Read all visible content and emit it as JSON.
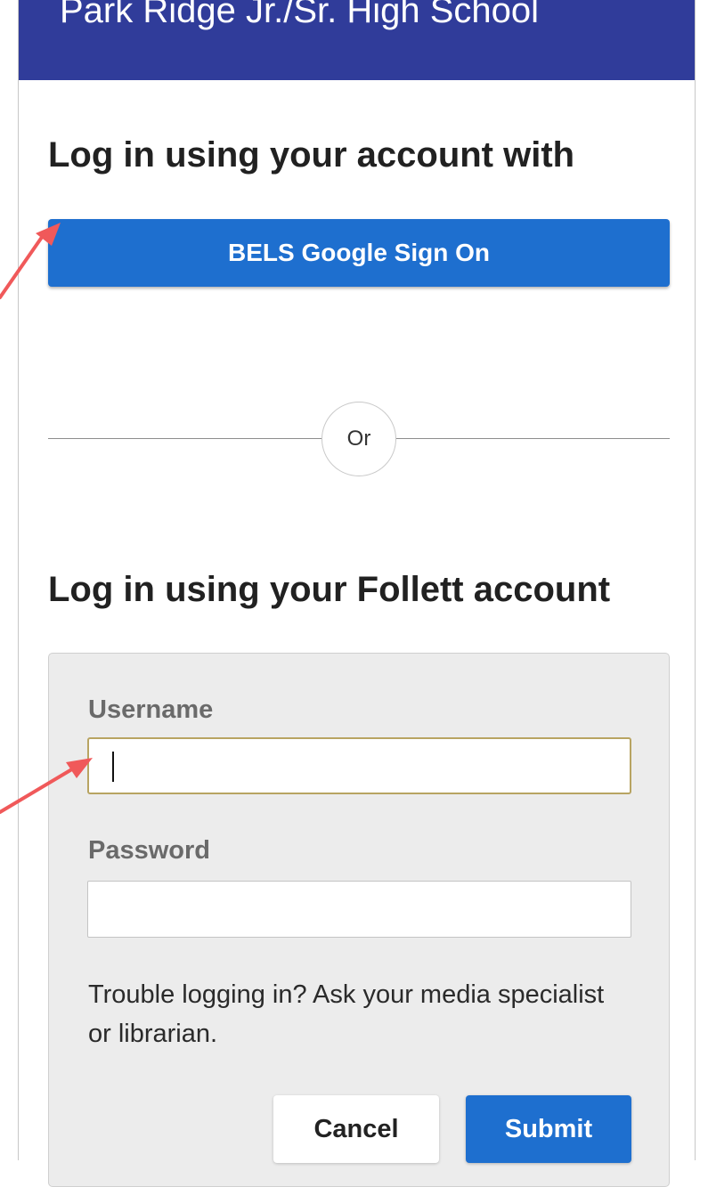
{
  "header": {
    "school_name": "Park Ridge Jr./Sr. High School"
  },
  "sso_section": {
    "heading": "Log in using your account with",
    "button_label": "BELS Google Sign On"
  },
  "divider": {
    "label": "Or"
  },
  "follett_section": {
    "heading": "Log in using your Follett account",
    "username_label": "Username",
    "username_value": "",
    "password_label": "Password",
    "password_value": "",
    "help_text": "Trouble logging in? Ask your media specialist or librarian.",
    "cancel_label": "Cancel",
    "submit_label": "Submit"
  },
  "colors": {
    "header_bg": "#303c9a",
    "primary_button": "#1e6fcf",
    "focused_input_border": "#b8a462",
    "annotation_arrow": "#f0595a"
  },
  "annotations": [
    {
      "points_to": "sso-button",
      "icon": "arrow-annotation-icon"
    },
    {
      "points_to": "username-input",
      "icon": "arrow-annotation-icon"
    }
  ]
}
